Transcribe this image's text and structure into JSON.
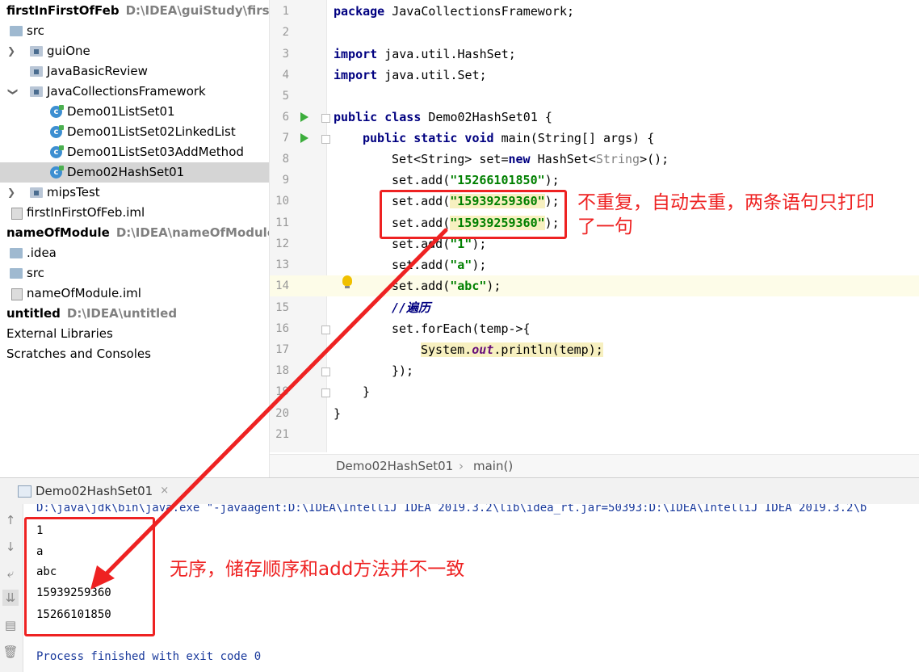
{
  "project_tree": {
    "rows": [
      {
        "label": "firstInFirstOfFeb",
        "path": "D:\\IDEA\\guiStudy\\firstInFirs"
      },
      {
        "label": "src"
      },
      {
        "label": "guiOne"
      },
      {
        "label": "JavaBasicReview"
      },
      {
        "label": "JavaCollectionsFramework"
      },
      {
        "label": "Demo01ListSet01"
      },
      {
        "label": "Demo01ListSet02LinkedList"
      },
      {
        "label": "Demo01ListSet03AddMethod"
      },
      {
        "label": "Demo02HashSet01"
      },
      {
        "label": "mipsTest"
      },
      {
        "label": "firstInFirstOfFeb.iml"
      },
      {
        "label": "nameOfModule",
        "path": "D:\\IDEA\\nameOfModule"
      },
      {
        "label": ".idea"
      },
      {
        "label": "src"
      },
      {
        "label": "nameOfModule.iml"
      },
      {
        "label": "untitled",
        "path": "D:\\IDEA\\untitled"
      },
      {
        "label": "External Libraries"
      },
      {
        "label": "Scratches and Consoles"
      }
    ]
  },
  "editor": {
    "line_numbers": [
      "1",
      "2",
      "3",
      "4",
      "5",
      "6",
      "7",
      "8",
      "9",
      "10",
      "11",
      "12",
      "13",
      "14",
      "15",
      "16",
      "17",
      "18",
      "19",
      "20",
      "21"
    ],
    "code": {
      "l1_kw": "package",
      "l1_rest": " JavaCollectionsFramework;",
      "l3_kw": "import",
      "l3_rest": " java.util.HashSet;",
      "l4_kw": "import",
      "l4_rest": " java.util.Set;",
      "l6_kw": "public class",
      "l6_rest": " Demo02HashSet01 {",
      "l7_kw": "public static void",
      "l7_rest": " main(String[] args) {",
      "l8_a": "Set<String> set=",
      "l8_kw": "new",
      "l8_b": " HashSet<",
      "l8_gray": "String",
      "l8_c": ">();",
      "l9_a": "set.add(",
      "l9_str": "\"15266101850\"",
      "l9_b": ");",
      "l10_a": "set.add(",
      "l10_str": "\"15939259360\"",
      "l10_b": ");",
      "l11_a": "set.add(",
      "l11_str": "\"15939259360\"",
      "l11_b": ");",
      "l12_a": "set.add(",
      "l12_str": "\"1\"",
      "l12_b": ");",
      "l13_a": "set.add(",
      "l13_str": "\"a\"",
      "l13_b": ");",
      "l14_a": "set.add(",
      "l14_str": "\"abc\"",
      "l14_b": ");",
      "l15_cmt": "//遍历",
      "l16": "set.forEach(temp->{",
      "l17_a": "System.",
      "l17_field": "out",
      "l17_b": ".println(temp);",
      "l18": "});",
      "l19": "}",
      "l20": "}"
    },
    "breadcrumb": {
      "class_name": "Demo02HashSet01",
      "separator": "›",
      "method": "main()"
    }
  },
  "run_panel": {
    "tab_label": "Demo02HashSet01",
    "tab_close": "×",
    "command_line": "D:\\java\\jdk\\bin\\java.exe \"-javaagent:D:\\IDEA\\IntelliJ IDEA 2019.3.2\\lib\\idea_rt.jar=50393:D:\\IDEA\\IntelliJ IDEA 2019.3.2\\b",
    "output": [
      "1",
      "a",
      "abc",
      "15939259360",
      "15266101850"
    ],
    "exit_message": "Process finished with exit code 0"
  },
  "annotations": {
    "note_duplicates_line1": "不重复，自动去重，两条语句只打印",
    "note_duplicates_line2": "了一句",
    "note_unordered": "无序，储存顺序和add方法并不一致",
    "color": "#ee2222"
  }
}
